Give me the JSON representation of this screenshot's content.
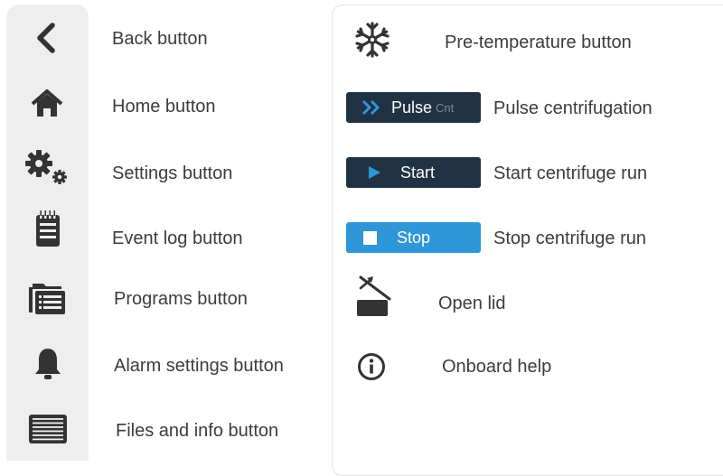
{
  "sidebar": {
    "items": [
      {
        "icon": "back-icon",
        "label": "Back button"
      },
      {
        "icon": "home-icon",
        "label": "Home button"
      },
      {
        "icon": "gear-icon",
        "label": "Settings button"
      },
      {
        "icon": "event-log-icon",
        "label": "Event log button"
      },
      {
        "icon": "programs-icon",
        "label": "Programs button"
      },
      {
        "icon": "bell-icon",
        "label": "Alarm settings button"
      },
      {
        "icon": "files-info-icon",
        "label": "Files and info button"
      }
    ]
  },
  "panel": {
    "pre_temperature": {
      "icon": "snowflake-icon",
      "label": "Pre-temperature button"
    },
    "pulse": {
      "button_text": "Pulse",
      "button_sub": "Cnt",
      "label": "Pulse centrifugation"
    },
    "start": {
      "button_text": "Start",
      "label": "Start centrifuge run"
    },
    "stop": {
      "button_text": "Stop",
      "label": "Stop centrifuge run"
    },
    "open_lid": {
      "icon": "open-lid-icon",
      "label": "Open lid"
    },
    "help": {
      "icon": "info-icon",
      "label": "Onboard help"
    }
  },
  "colors": {
    "icon": "#333333",
    "dark_button": "#203244",
    "blue_button": "#2f97d8",
    "accent_blue": "#2f97d8",
    "sidebar_bg": "#eeeeee"
  }
}
